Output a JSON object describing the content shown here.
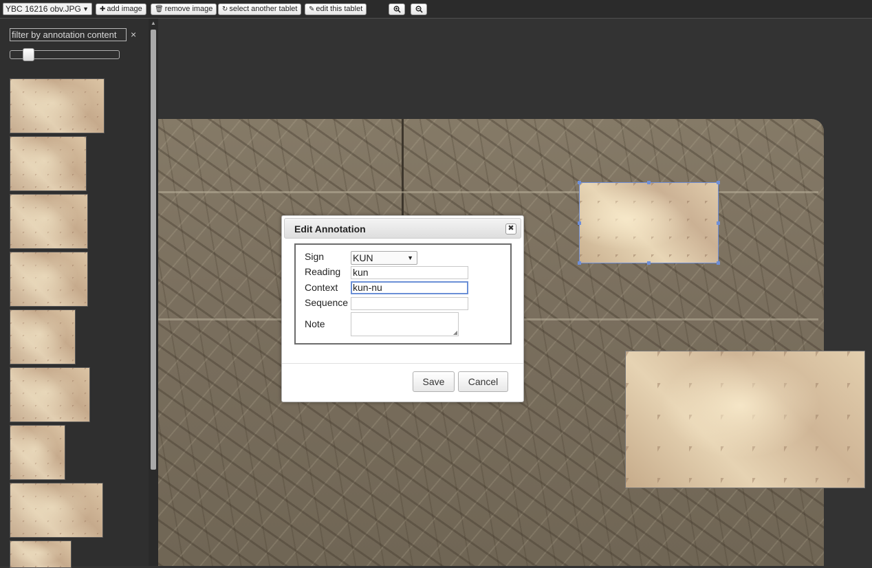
{
  "toolbar": {
    "image_select_value": "YBC 16216 obv.JPG",
    "buttons": {
      "add_image": "add image",
      "remove_image": "remove image",
      "select_tablet": "select another tablet",
      "edit_tablet": "edit this tablet"
    },
    "icons": {
      "add": "plus-icon",
      "remove": "trash-icon",
      "select": "refresh-icon",
      "edit": "pencil-icon",
      "zoom_in": "zoom-in-icon",
      "zoom_out": "zoom-out-icon"
    }
  },
  "sidebar": {
    "filter_placeholder": "filter by annotation content",
    "filter_clear": "×",
    "slider_value": 0.13,
    "thumbnail_count": 9
  },
  "dialog": {
    "title": "Edit Annotation",
    "close": "✖",
    "fields": {
      "sign": {
        "label": "Sign",
        "value": "KUN"
      },
      "reading": {
        "label": "Reading",
        "value": "kun"
      },
      "context": {
        "label": "Context",
        "value": "kun-nu"
      },
      "sequence": {
        "label": "Sequence",
        "value": ""
      },
      "note": {
        "label": "Note",
        "value": ""
      }
    },
    "save_label": "Save",
    "cancel_label": "Cancel"
  },
  "colors": {
    "background": "#333333",
    "selection": "#6f8fd8",
    "focus": "#6a8fd6"
  }
}
